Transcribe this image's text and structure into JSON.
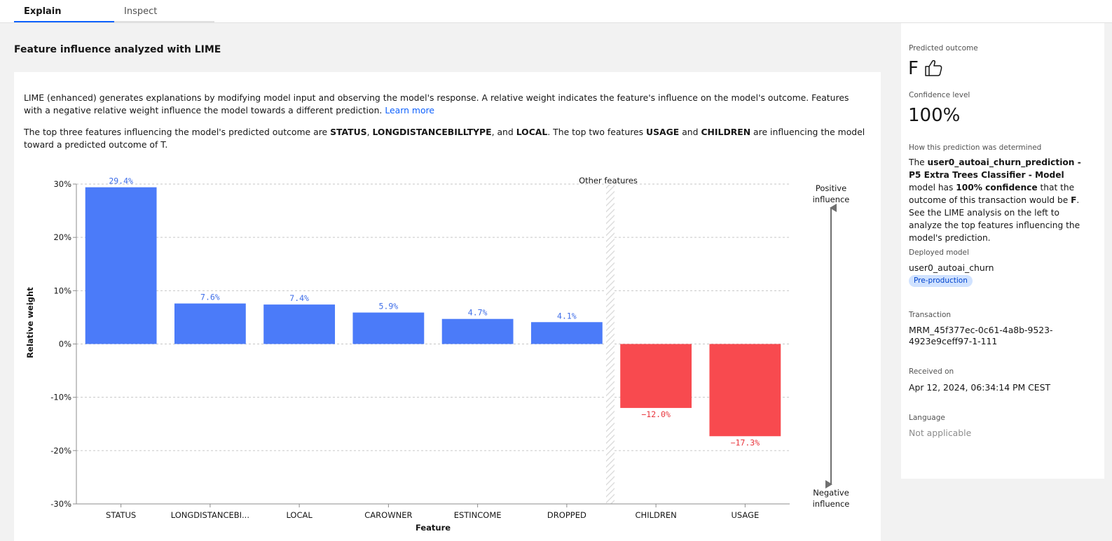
{
  "tabs": [
    {
      "label": "Explain",
      "active": true
    },
    {
      "label": "Inspect",
      "active": false
    }
  ],
  "section_title": "Feature influence analyzed with LIME",
  "description": {
    "p1_text": "LIME (enhanced) generates explanations by modifying model input and observing the model's response. A relative weight indicates the feature's influence on the model's outcome. Features with a negative relative weight influence the model towards a different prediction.",
    "learn_more": "Learn more",
    "p2_a": "The top three features influencing the model's predicted outcome are ",
    "p2_f1": "STATUS",
    "p2_b": ", ",
    "p2_f2": "LONGDISTANCEBILLTYPE",
    "p2_c": ", and ",
    "p2_f3": "LOCAL",
    "p2_d": ". The top two features ",
    "p2_f4": "USAGE",
    "p2_e": " and ",
    "p2_f5": "CHILDREN",
    "p2_f": " are influencing the model toward a predicted outcome of T."
  },
  "chart_data": {
    "type": "bar",
    "categories": [
      "STATUS",
      "LONGDISTANCEBI...",
      "LOCAL",
      "CAROWNER",
      "ESTINCOME",
      "DROPPED",
      "CHILDREN",
      "USAGE"
    ],
    "values": [
      29.4,
      7.6,
      7.4,
      5.9,
      4.7,
      4.1,
      -12.0,
      -17.3
    ],
    "value_labels": [
      "29.4%",
      "7.6%",
      "7.4%",
      "5.9%",
      "4.7%",
      "4.1%",
      "−12.0%",
      "−17.3%"
    ],
    "xlabel": "Feature",
    "ylabel": "Relative weight",
    "ylim": [
      -30,
      30
    ],
    "yticks": [
      30,
      20,
      10,
      0,
      -10,
      -20,
      -30
    ],
    "ytick_labels": [
      "30%",
      "20%",
      "10%",
      "0%",
      "-10%",
      "-20%",
      "-30%"
    ],
    "grid": true,
    "annotation": "Other features",
    "positive_label_1": "Positive",
    "positive_label_2": "influence",
    "negative_label_1": "Negative",
    "negative_label_2": "influence",
    "colors": {
      "positive": "#4b7bf9",
      "negative": "#f84a4f",
      "positive_text": "#3f6ee8",
      "negative_text": "#e8343b"
    }
  },
  "side_panel": {
    "predicted_outcome_label": "Predicted outcome",
    "predicted_outcome": "F",
    "outcome_icon": "thumbs-up-icon",
    "confidence_label": "Confidence level",
    "confidence": "100%",
    "how_label": "How this prediction was determined",
    "how_a": "The ",
    "how_model": "user0_autoai_churn_prediction - P5 Extra Trees Classifier - Model",
    "how_b": " model has ",
    "how_conf": "100% confidence",
    "how_c": " that the outcome of this transaction would be ",
    "how_outcome": "F",
    "how_d": ". See the LIME analysis on the left to analyze the top features influencing the model's prediction.",
    "deployed_label": "Deployed model",
    "deployed_model": "user0_autoai_churn",
    "deployed_badge": "Pre-production",
    "transaction_label": "Transaction",
    "transaction_id_1": "MRM_45f377ec-0c61-4a8b-9523-",
    "transaction_id_2": "4923e9ceff97-1-111",
    "received_label": "Received on",
    "received_value": "Apr 12, 2024, 06:34:14 PM CEST",
    "language_label": "Language",
    "language_value": "Not applicable"
  }
}
